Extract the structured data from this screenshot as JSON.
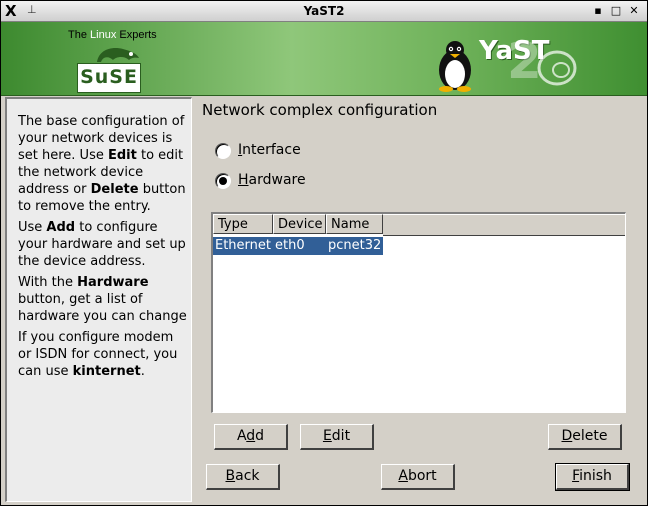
{
  "window": {
    "title": "YaST2"
  },
  "banner": {
    "tagline_pre": "The ",
    "tagline_highlight": "Linux",
    "tagline_post": " Experts",
    "suse_logo_text": "SuSE",
    "yast_logo_text": "YaST"
  },
  "help": {
    "paragraphs": [
      [
        "The base configuration of your network devices is set here. Use ",
        "Edit",
        " to edit the network device address or ",
        "Delete",
        " button to remove the entry."
      ],
      [
        "Use ",
        "Add",
        " to configure your hardware and set up the device address."
      ],
      [
        "With the ",
        "Hardware",
        " button, get a list of hardware you can change"
      ],
      [
        "If you configure modem or ISDN for connect, you can use ",
        "kinternet",
        "."
      ]
    ]
  },
  "main": {
    "heading": "Network complex configuration",
    "radios": [
      {
        "label_underlined": "I",
        "label_rest": "nterface",
        "selected": false
      },
      {
        "label_underlined": "H",
        "label_rest": "ardware",
        "selected": true
      }
    ],
    "table": {
      "columns": [
        "Type",
        "Device",
        "Name"
      ],
      "rows": [
        {
          "type": "Ethernet",
          "device": "eth0",
          "name": "pcnet32",
          "selected": true
        }
      ]
    }
  },
  "buttons": {
    "add": {
      "pre": "A",
      "u": "d",
      "post": "d"
    },
    "edit": {
      "pre": "",
      "u": "E",
      "post": "dit"
    },
    "delete": {
      "pre": "",
      "u": "D",
      "post": "elete"
    },
    "back": {
      "pre": "",
      "u": "B",
      "post": "ack"
    },
    "abort": {
      "pre": "",
      "u": "A",
      "post": "bort"
    },
    "finish": {
      "pre": "",
      "u": "F",
      "post": "inish"
    }
  }
}
